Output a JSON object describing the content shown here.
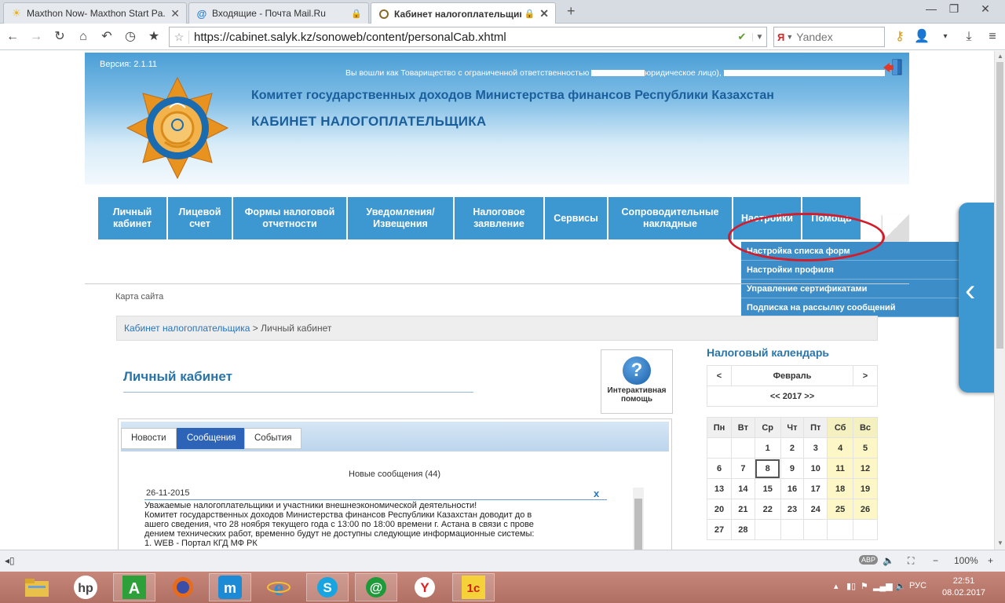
{
  "browser": {
    "tabs": [
      {
        "title": "Maxthon Now- Maxthon Start Pa...",
        "icon": "sun-icon"
      },
      {
        "title": "Входящие - Почта Mail.Ru",
        "icon": "mail-at-icon"
      },
      {
        "title": "Кабинет налогоплательщика ...",
        "icon": "ring-icon"
      }
    ],
    "url": "https://cabinet.salyk.kz/sonoweb/content/personalCab.xhtml",
    "search_placeholder": "Yandex",
    "zoom": "100%"
  },
  "header": {
    "version": "Версия: 2.1.11",
    "logged_in_start": "Вы вошли как Товарищество с ограниченной ответственностью",
    "logged_in_end": "юридическое лицо),",
    "committee": "Комитет государственных доходов Министерства финансов Республики Казахстан",
    "cabinet": "КАБИНЕТ НАЛОГОПЛАТЕЛЬЩИКА"
  },
  "menu": [
    {
      "label": "Личный кабинет",
      "width": 87
    },
    {
      "label": "Лицевой счет",
      "width": 81
    },
    {
      "label": "Формы налоговой отчетности",
      "width": 144
    },
    {
      "label": "Уведомления/ Извещения",
      "width": 134
    },
    {
      "label": "Налоговое заявление",
      "width": 113
    },
    {
      "label": "Сервисы",
      "width": 79
    },
    {
      "label": "Сопроводительные накладные",
      "width": 157
    },
    {
      "label": "Настройки",
      "width": 86
    },
    {
      "label": "Помощь",
      "width": 74
    }
  ],
  "settings_dropdown": [
    "Настройка списка форм",
    "Настройки профиля",
    "Управление сертификатами",
    "Подписка на рассылку сообщений"
  ],
  "sitemap": "Карта сайта",
  "breadcrumb": {
    "link": "Кабинет налогоплательщика",
    "sep": " > ",
    "current": "Личный кабинет"
  },
  "page_title": "Личный кабинет",
  "help": {
    "label": "Интерактивная помощь"
  },
  "panel_tabs": [
    "Новости",
    "Сообщения",
    "События"
  ],
  "messages": {
    "heading": "Новые сообщения (44)",
    "date": "26-11-2015",
    "close": "x",
    "text": "Уважаемые налогоплательщики и участники внешнеэкономической деятельности!\nКомитет государственных доходов Министерства финансов Республики Казахстан доводит до в\nашего сведения, что 28 ноября текущего года с 13:00 по 18:00 времени г. Астана в связи с прове\nдением технических работ, временно будут не доступны следующие информационные системы:\n1. WEB - Портал КГД МФ РК"
  },
  "calendar": {
    "title": "Налоговый календарь",
    "prev": "<",
    "next": ">",
    "month": "Февраль",
    "year": "<< 2017 >>",
    "days": [
      "Пн",
      "Вт",
      "Ср",
      "Чт",
      "Пт",
      "Сб",
      "Вс"
    ],
    "weeks": [
      [
        "",
        "",
        "1",
        "2",
        "3",
        "4",
        "5"
      ],
      [
        "6",
        "7",
        "8",
        "9",
        "10",
        "11",
        "12"
      ],
      [
        "13",
        "14",
        "15",
        "16",
        "17",
        "18",
        "19"
      ],
      [
        "20",
        "21",
        "22",
        "23",
        "24",
        "25",
        "26"
      ],
      [
        "27",
        "28",
        "",
        "",
        "",
        "",
        ""
      ]
    ],
    "today": "8"
  },
  "taskbar": {
    "lang": "РУС",
    "time": "22:51",
    "date": "08.02.2017"
  },
  "colors": {
    "menu_blue": "#3d97d1",
    "dropdown_blue": "#3d8ec8",
    "title_blue": "#1a5f9c",
    "highlight_red": "#d31b2a",
    "weekend_yellow": "#fdf7c7"
  }
}
